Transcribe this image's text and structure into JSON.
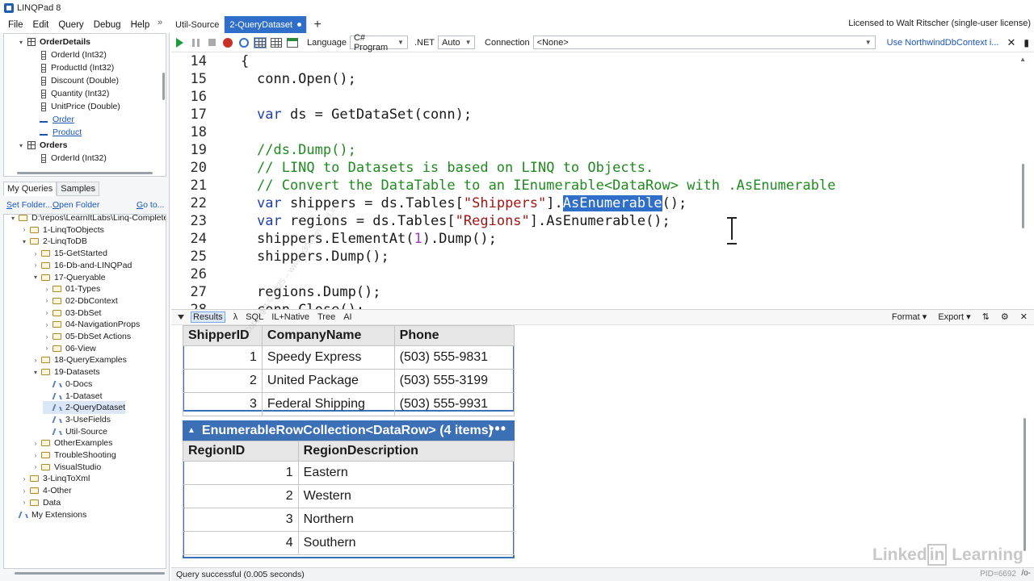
{
  "app": {
    "title": "LINQPad 8",
    "license": "Licensed to Walt Ritscher (single-user license)"
  },
  "menu": [
    {
      "id": "file",
      "label": "File"
    },
    {
      "id": "edit",
      "label": "Edit"
    },
    {
      "id": "query",
      "label": "Query"
    },
    {
      "id": "debug",
      "label": "Debug"
    },
    {
      "id": "help",
      "label": "Help"
    }
  ],
  "menu_overflow": "»",
  "tabs": [
    {
      "label": "Util-Source",
      "active": false
    },
    {
      "label": "2-QueryDataset",
      "active": true,
      "modified": true
    }
  ],
  "tab_add": "+",
  "schema_tree": [
    {
      "label": "OrderDetails",
      "kind": "table",
      "bold": true,
      "expanded": true,
      "depth": 0
    },
    {
      "label": "OrderId (Int32)",
      "kind": "column",
      "depth": 1
    },
    {
      "label": "ProductId (Int32)",
      "kind": "column",
      "depth": 1
    },
    {
      "label": "Discount (Double)",
      "kind": "column",
      "depth": 1
    },
    {
      "label": "Quantity (Int32)",
      "kind": "column",
      "depth": 1
    },
    {
      "label": "UnitPrice (Double)",
      "kind": "column",
      "depth": 1
    },
    {
      "label": "Order",
      "kind": "link",
      "depth": 1
    },
    {
      "label": "Product",
      "kind": "link",
      "depth": 1
    },
    {
      "label": "Orders",
      "kind": "table",
      "bold": true,
      "expanded": true,
      "depth": 0
    },
    {
      "label": "OrderId (Int32)",
      "kind": "column",
      "depth": 1
    }
  ],
  "query_tabs": [
    {
      "label": "My Queries",
      "active": true
    },
    {
      "label": "Samples",
      "active": false
    }
  ],
  "query_links": {
    "set_folder": "Set Folder...",
    "open_folder": "Open Folder",
    "go_to": "Go to..."
  },
  "query_tree": [
    {
      "label": "D:\\repos\\LearnItLabs\\Linq-Complete\\c",
      "kind": "folder",
      "depth": 0,
      "expanded": true
    },
    {
      "label": "1-LinqToObjects",
      "kind": "folder",
      "depth": 1,
      "expanded": false
    },
    {
      "label": "2-LinqToDB",
      "kind": "folder",
      "depth": 1,
      "expanded": true
    },
    {
      "label": "15-GetStarted",
      "kind": "folder",
      "depth": 2,
      "expanded": false
    },
    {
      "label": "16-Db-and-LINQPad",
      "kind": "folder",
      "depth": 2,
      "expanded": false
    },
    {
      "label": "17-Queryable",
      "kind": "folder",
      "depth": 2,
      "expanded": true
    },
    {
      "label": "01-Types",
      "kind": "folder",
      "depth": 3,
      "expanded": false
    },
    {
      "label": "02-DbContext",
      "kind": "folder",
      "depth": 3,
      "expanded": false
    },
    {
      "label": "03-DbSet",
      "kind": "folder",
      "depth": 3,
      "expanded": false
    },
    {
      "label": "04-NavigationProps",
      "kind": "folder",
      "depth": 3,
      "expanded": false
    },
    {
      "label": "05-DbSet Actions",
      "kind": "folder",
      "depth": 3,
      "expanded": false
    },
    {
      "label": "06-View",
      "kind": "folder",
      "depth": 3,
      "expanded": false
    },
    {
      "label": "18-QueryExamples",
      "kind": "folder",
      "depth": 2,
      "expanded": false
    },
    {
      "label": "19-Datasets",
      "kind": "folder",
      "depth": 2,
      "expanded": true
    },
    {
      "label": "0-Docs",
      "kind": "query",
      "depth": 3
    },
    {
      "label": "1-Dataset",
      "kind": "query",
      "depth": 3
    },
    {
      "label": "2-QueryDataset",
      "kind": "query",
      "depth": 3,
      "selected": true
    },
    {
      "label": "3-UseFields",
      "kind": "query",
      "depth": 3
    },
    {
      "label": "Util-Source",
      "kind": "query",
      "depth": 3
    },
    {
      "label": "OtherExamples",
      "kind": "folder",
      "depth": 2,
      "expanded": false
    },
    {
      "label": "TroubleShooting",
      "kind": "folder",
      "depth": 2,
      "expanded": false
    },
    {
      "label": "VisualStudio",
      "kind": "folder",
      "depth": 2,
      "expanded": false
    },
    {
      "label": "3-LinqToXml",
      "kind": "folder",
      "depth": 1,
      "expanded": false
    },
    {
      "label": "4-Other",
      "kind": "folder",
      "depth": 1,
      "expanded": false
    },
    {
      "label": "Data",
      "kind": "folder",
      "depth": 1,
      "expanded": false
    },
    {
      "label": "My Extensions",
      "kind": "query",
      "depth": 0
    }
  ],
  "toolbar": {
    "language_label": "Language",
    "language_value": "C# Program",
    "net_label": ".NET",
    "net_value": "Auto",
    "connection_label": "Connection",
    "connection_value": "<None>",
    "use_context_link": "Use NorthwindDbContext i..."
  },
  "code_lines": [
    {
      "n": "14",
      "tokens": [
        [
          "p",
          "{"
        ]
      ],
      "indent": 0
    },
    {
      "n": "15",
      "tokens": [
        [
          "p",
          "conn.Open();"
        ]
      ],
      "indent": 1
    },
    {
      "n": "16",
      "tokens": [],
      "indent": 1
    },
    {
      "n": "17",
      "tokens": [
        [
          "kw",
          "var"
        ],
        [
          "p",
          " ds = GetDataSet(conn);"
        ]
      ],
      "indent": 1
    },
    {
      "n": "18",
      "tokens": [],
      "indent": 1
    },
    {
      "n": "19",
      "tokens": [
        [
          "cm",
          "//ds.Dump();"
        ]
      ],
      "indent": 1
    },
    {
      "n": "20",
      "tokens": [
        [
          "cm",
          "// LINQ to Datasets is based on LINQ to Objects."
        ]
      ],
      "indent": 1
    },
    {
      "n": "21",
      "tokens": [
        [
          "cm",
          "// Convert the DataTable to an IEnumerable<DataRow> with .AsEnumerable"
        ]
      ],
      "indent": 1
    },
    {
      "n": "22",
      "tokens": [
        [
          "kw",
          "var"
        ],
        [
          "p",
          " shippers = ds.Tables["
        ],
        [
          "str",
          "\"Shippers\""
        ],
        [
          "p",
          "]."
        ],
        [
          "hl",
          "AsEnumerable"
        ],
        [
          "p",
          "();"
        ]
      ],
      "indent": 1
    },
    {
      "n": "23",
      "tokens": [
        [
          "kw",
          "var"
        ],
        [
          "p",
          " regions = ds.Tables["
        ],
        [
          "str",
          "\"Regions\""
        ],
        [
          "p",
          "].AsEnumerable();"
        ]
      ],
      "indent": 1
    },
    {
      "n": "24",
      "tokens": [
        [
          "p",
          "shippers.ElementAt("
        ],
        [
          "num",
          "1"
        ],
        [
          "p",
          ").Dump();"
        ]
      ],
      "indent": 1
    },
    {
      "n": "25",
      "tokens": [
        [
          "p",
          "shippers.Dump();"
        ]
      ],
      "indent": 1
    },
    {
      "n": "26",
      "tokens": [],
      "indent": 1
    },
    {
      "n": "27",
      "tokens": [
        [
          "p",
          "regions.Dump();"
        ]
      ],
      "indent": 1
    },
    {
      "n": "28",
      "tokens": [
        [
          "p",
          "conn.Close();"
        ]
      ],
      "indent": 1
    }
  ],
  "results_bar": {
    "results": "Results",
    "lambda": "λ",
    "sql": "SQL",
    "il": "IL+Native",
    "tree": "Tree",
    "ai": "AI",
    "format": "Format",
    "export": "Export"
  },
  "shippers_table": {
    "columns": [
      "ShipperID",
      "CompanyName",
      "Phone"
    ],
    "rows": [
      [
        "1",
        "Speedy Express",
        "(503) 555-9831"
      ],
      [
        "2",
        "United Package",
        "(503) 555-3199"
      ],
      [
        "3",
        "Federal Shipping",
        "(503) 555-9931"
      ]
    ]
  },
  "regions_table": {
    "header": "EnumerableRowCollection<DataRow> (4 items)",
    "more": "•••",
    "columns": [
      "RegionID",
      "RegionDescription"
    ],
    "rows": [
      [
        "1",
        "Eastern"
      ],
      [
        "2",
        "Western"
      ],
      [
        "3",
        "Northern"
      ],
      [
        "4",
        "Southern"
      ]
    ]
  },
  "watermark": {
    "left": "Linked",
    "boxed": "in",
    "right": " Learning"
  },
  "diag_watermark": "Copyright © 2025 – www.p30download.ir",
  "status": {
    "text": "Query successful  (0.005 seconds)",
    "pid": "PID=6692",
    "sep": "/o-"
  },
  "colors": {
    "accent": "#2f6fc9",
    "table_header": "#3b6fb6",
    "keyword": "#1f3fb0",
    "string": "#a31515",
    "comment": "#1f8a1f"
  }
}
